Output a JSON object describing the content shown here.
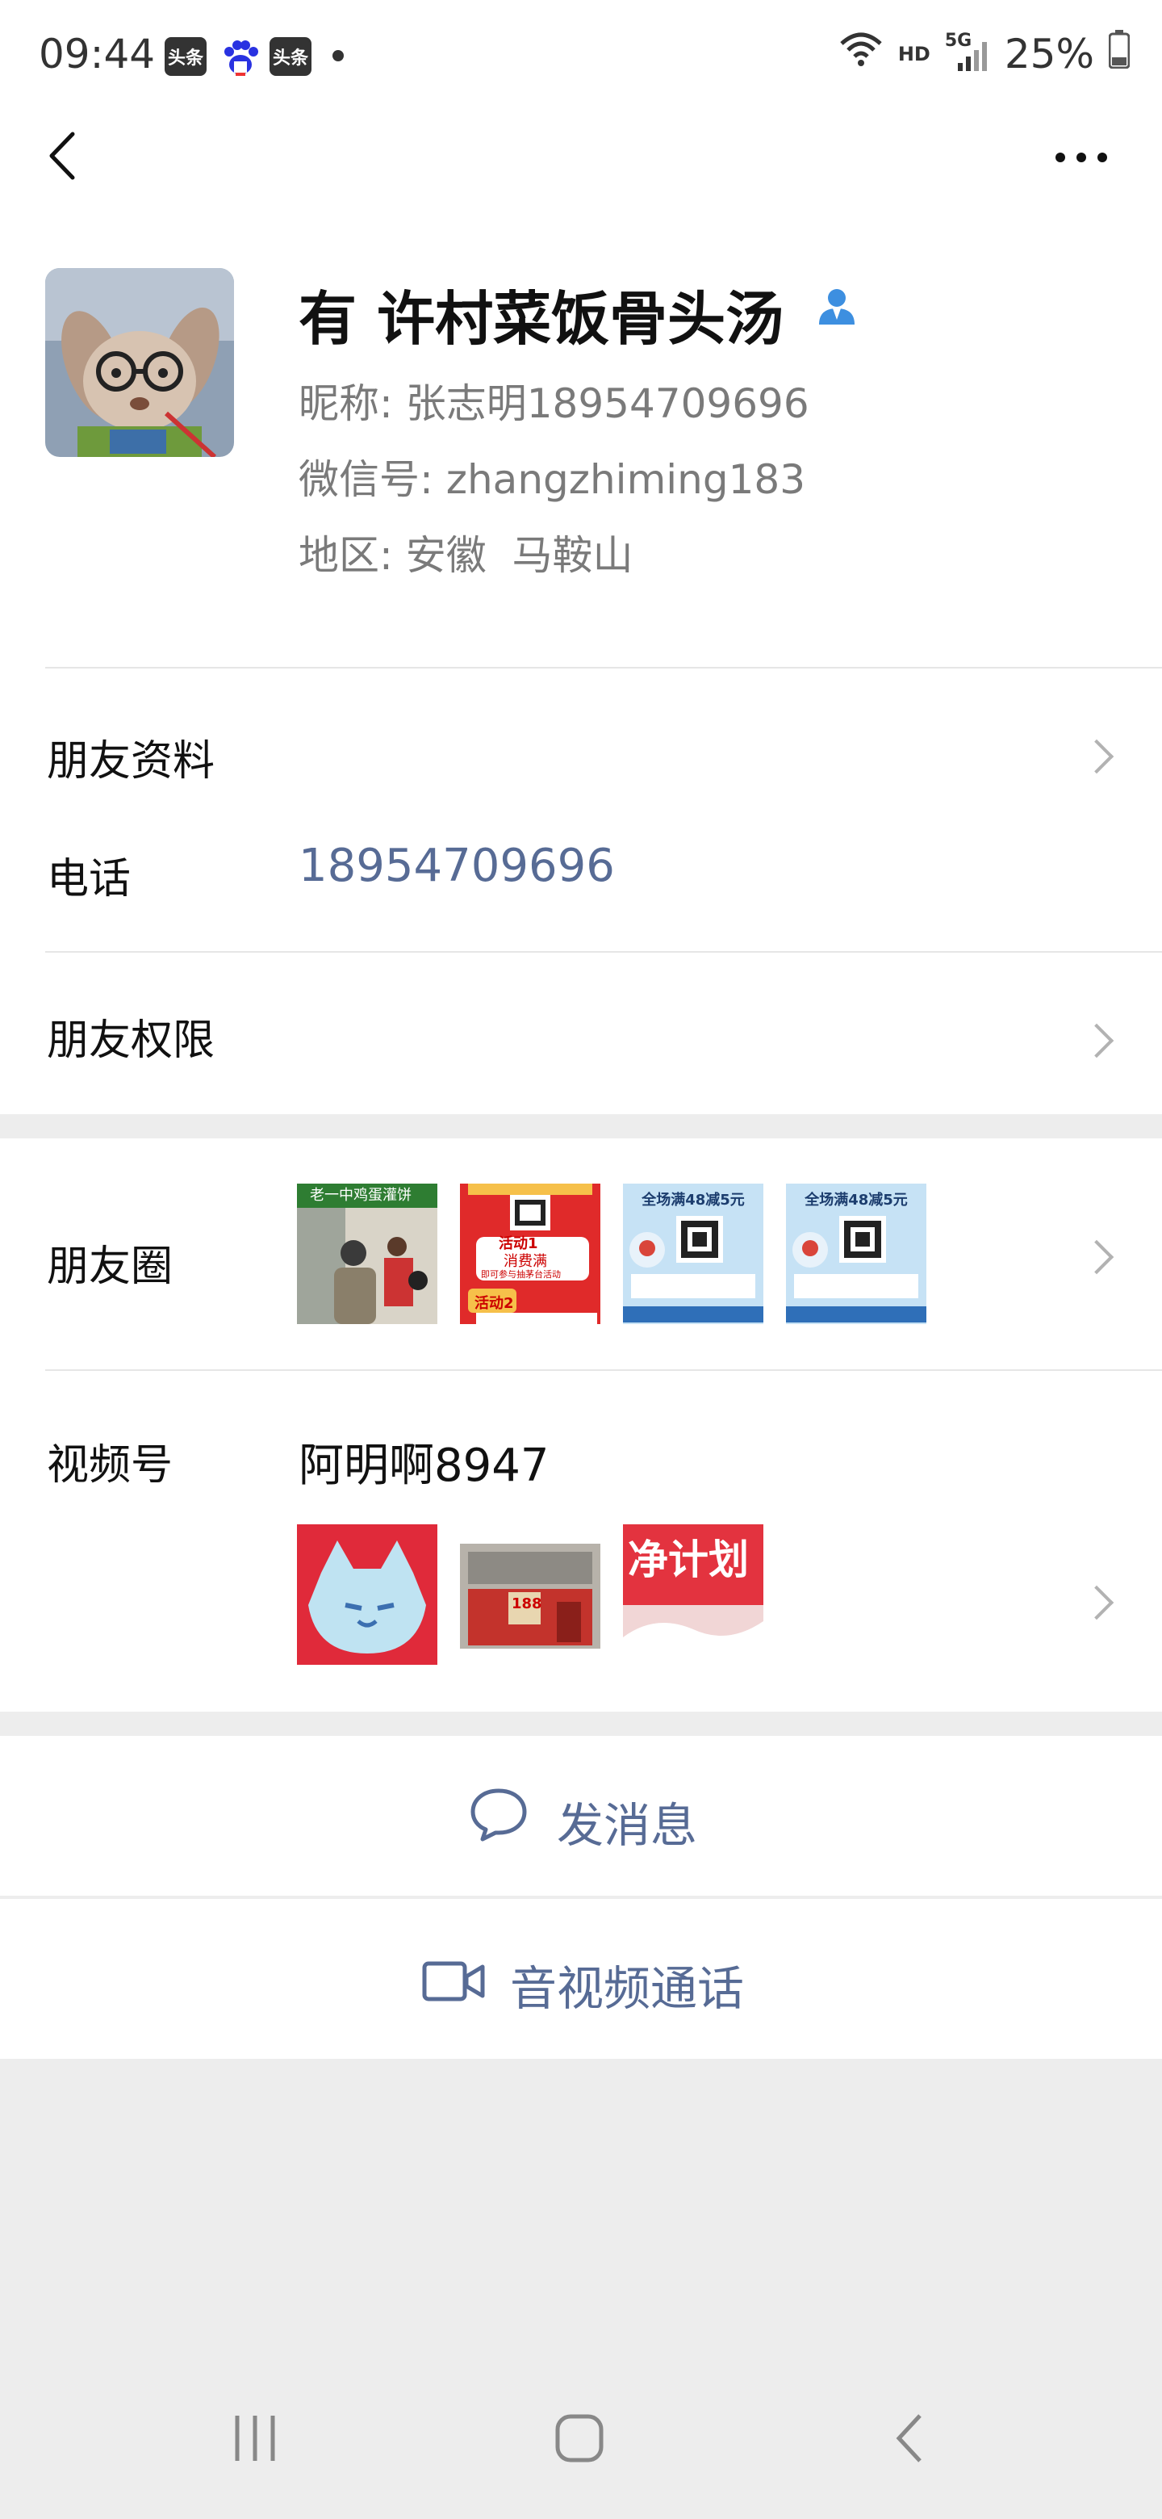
{
  "status_bar": {
    "time": "09:44",
    "badges": [
      "头条",
      "头条"
    ],
    "network_hd": "HD",
    "network_5g": "5G",
    "battery": "25%"
  },
  "profile": {
    "name": "有 许村菜饭骨头汤",
    "nickname": "昵称: 张志明18954709696",
    "wechat_id": "微信号: zhangzhiming183",
    "region": "地区: 安徽  马鞍山"
  },
  "rows": {
    "friend_info": "朋友资料",
    "phone_label": "电话",
    "phone_value": "18954709696",
    "permissions": "朋友权限",
    "moments": "朋友圈",
    "channels_label": "视频号",
    "channels_name": "阿明啊8947"
  },
  "moments_thumbs": {
    "t1_text": "老一中鸡蛋灌饼",
    "t2_text_a": "活动1",
    "t2_text_b": "消费满",
    "t2_text_c": "即可参与抽茅台活动",
    "t2_text_d": "活动2",
    "t3_text": "全场满48减5元",
    "t4_text": "全场满48减5元"
  },
  "channels_thumbs": {
    "c2_text": "188",
    "c3_text": "净计划"
  },
  "actions": {
    "message": "发消息",
    "call": "音视频通话"
  },
  "colors": {
    "link": "#576b95",
    "verified": "#3d8fe0",
    "background": "#ededed"
  }
}
